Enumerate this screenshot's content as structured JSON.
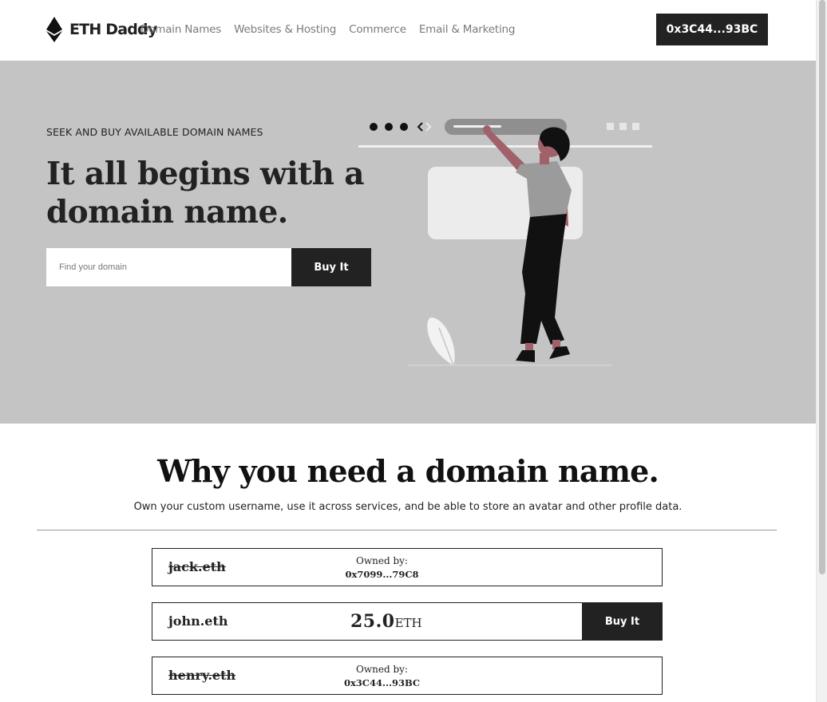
{
  "header": {
    "brand": "ETH Daddy",
    "nav_links": [
      "Domain Names",
      "Websites & Hosting",
      "Commerce",
      "Email & Marketing"
    ],
    "account_button": "0x3C44...93BC"
  },
  "hero": {
    "eyebrow": "SEEK AND BUY AVAILABLE DOMAIN NAMES",
    "title": "It all begins with a domain name.",
    "search_placeholder": "Find your domain",
    "buy_button": "Buy It"
  },
  "why": {
    "title": "Why you need a domain name.",
    "subtitle": "Own your custom username, use it across services, and be able to store an avatar and other profile data."
  },
  "domains": [
    {
      "name": "jack.eth",
      "status": "owned",
      "owned_label": "Owned by:",
      "owner": "0x7099...79C8"
    },
    {
      "name": "john.eth",
      "status": "available",
      "price": "25.0",
      "unit": "ETH",
      "buy_label": "Buy It"
    },
    {
      "name": "henry.eth",
      "status": "owned",
      "owned_label": "Owned by:",
      "owner": "0x3C44...93BC"
    }
  ],
  "colors": {
    "hero_bg": "#c4c4c4",
    "dark": "#222222",
    "accent": "#b36b72"
  },
  "icons": {
    "brand": "ethereum-icon"
  }
}
